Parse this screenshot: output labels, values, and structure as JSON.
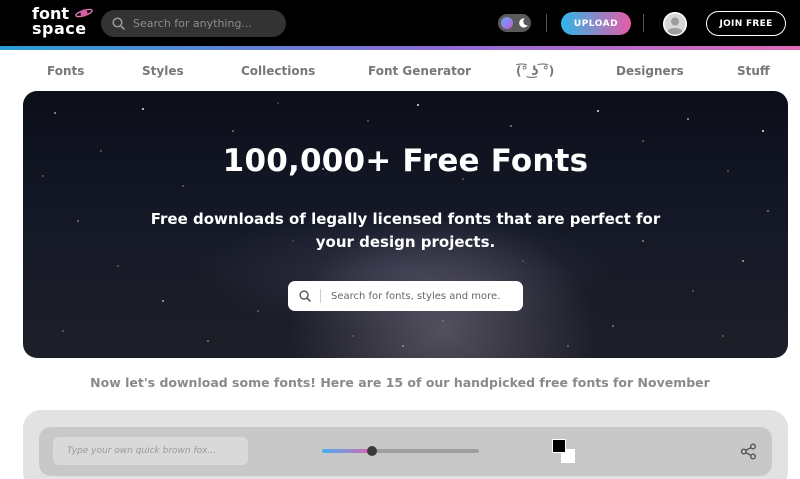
{
  "header": {
    "logo_line1": "font",
    "logo_line2": "space",
    "search_placeholder": "Search for anything...",
    "upload_label": "UPLOAD",
    "join_label": "JOIN FREE",
    "colors": {
      "background": "#000000",
      "accent_start": "#2db6e8",
      "accent_end": "#e55ca7"
    }
  },
  "nav": {
    "items": [
      {
        "label": "Fonts"
      },
      {
        "label": "Styles"
      },
      {
        "label": "Collections"
      },
      {
        "label": "Font Generator"
      },
      {
        "label": "(͡° ͜ʖ ͡°)"
      },
      {
        "label": "Designers"
      },
      {
        "label": "Stuff"
      }
    ]
  },
  "hero": {
    "title": "100,000+ Free Fonts",
    "subtitle": "Free downloads of legally licensed fonts that are perfect for your design projects.",
    "search_placeholder": "Search for fonts, styles and more."
  },
  "tagline": "Now let's download some fonts! Here are 15 of our handpicked free fonts for November",
  "preview": {
    "text_placeholder": "Type your own quick brown fox...",
    "font_size_fraction": 0.32,
    "foreground_color": "#000000",
    "background_color": "#ffffff"
  }
}
